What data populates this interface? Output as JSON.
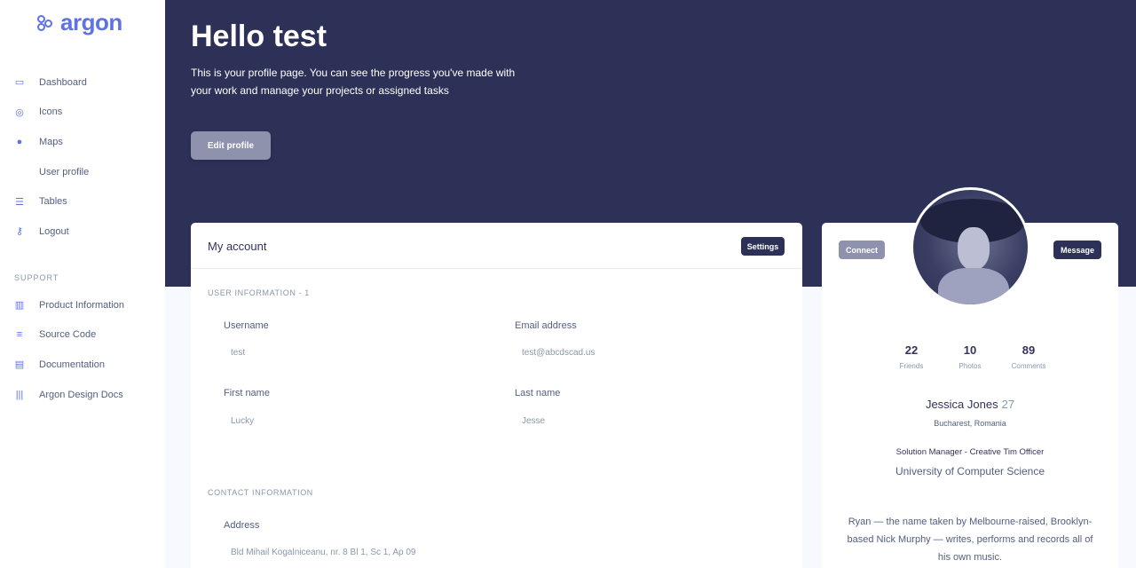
{
  "brand": {
    "name": "argon"
  },
  "sidebar": {
    "items": [
      {
        "label": "Dashboard",
        "icon": "tv-icon"
      },
      {
        "label": "Icons",
        "icon": "planet-icon"
      },
      {
        "label": "Maps",
        "icon": "pin-icon"
      },
      {
        "label": "User profile",
        "icon": "user-icon"
      },
      {
        "label": "Tables",
        "icon": "list-icon"
      },
      {
        "label": "Logout",
        "icon": "key-icon"
      }
    ],
    "support_heading": "SUPPORT",
    "support_items": [
      {
        "label": "Product Information",
        "icon": "book-icon"
      },
      {
        "label": "Source Code",
        "icon": "code-icon"
      },
      {
        "label": "Documentation",
        "icon": "book-open-icon"
      },
      {
        "label": "Argon Design Docs",
        "icon": "library-icon"
      }
    ]
  },
  "header": {
    "greeting": "Hello test",
    "intro": "This is your profile page. You can see the progress you've made with your work and manage your projects or assigned tasks",
    "edit_button": "Edit profile"
  },
  "account": {
    "title": "My account",
    "settings_button": "Settings",
    "user_info_heading": "USER INFORMATION - 1",
    "fields": {
      "username_label": "Username",
      "username_value": "test",
      "email_label": "Email address",
      "email_value": "test@abcdscad.us",
      "first_name_label": "First name",
      "first_name_value": "Lucky",
      "last_name_label": "Last name",
      "last_name_value": "Jesse"
    },
    "contact_heading": "CONTACT INFORMATION",
    "address_label": "Address",
    "address_value": "Bld Mihail Kogalniceanu, nr. 8 Bl 1, Sc 1, Ap 09"
  },
  "profile": {
    "connect_button": "Connect",
    "message_button": "Message",
    "stats": [
      {
        "value": "22",
        "label": "Friends"
      },
      {
        "value": "10",
        "label": "Photos"
      },
      {
        "value": "89",
        "label": "Comments"
      }
    ],
    "name": "Jessica Jones",
    "age": "27",
    "location": "Bucharest, Romania",
    "job": "Solution Manager - Creative Tim Officer",
    "school": "University of Computer Science",
    "bio": "Ryan — the name taken by Melbourne-raised, Brooklyn-based Nick Murphy — writes, performs and records all of his own music."
  }
}
